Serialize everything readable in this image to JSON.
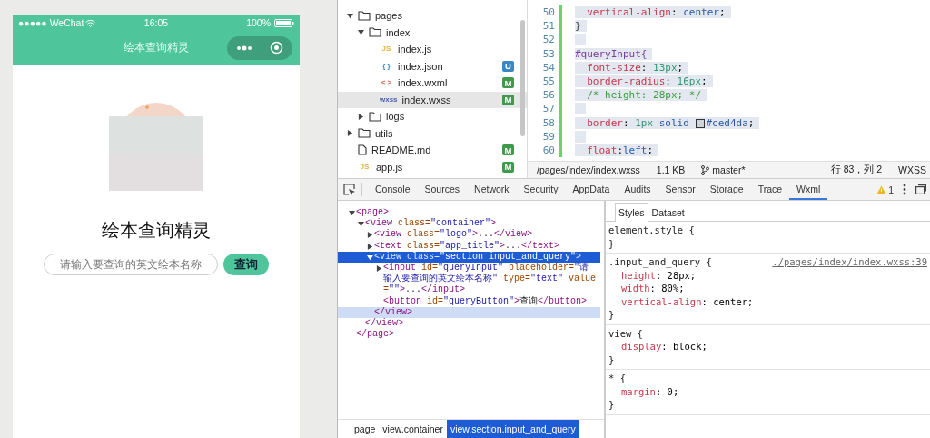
{
  "simulator": {
    "status_bar": {
      "carrier": "●●●●● WeChat",
      "time": "16:05",
      "battery": "100%"
    },
    "nav_title": "绘本查询精灵",
    "app": {
      "title": "绘本查询精灵",
      "search": {
        "placeholder": "请输入要查询的英文绘本名称"
      },
      "query_button": "查询"
    }
  },
  "file_tree": {
    "items": [
      {
        "name": "pages",
        "kind": "folder",
        "expanded": true,
        "selected": false,
        "children": [
          {
            "name": "index",
            "kind": "folder",
            "expanded": true,
            "selected": false,
            "children": [
              {
                "name": "index.js",
                "kind": "js",
                "icon_text": "JS",
                "selected": false
              },
              {
                "name": "index.json",
                "kind": "json",
                "icon_text": "{ }",
                "badge": {
                  "text": "U",
                  "color": "#3a87c5"
                },
                "selected": false
              },
              {
                "name": "index.wxml",
                "kind": "wxml",
                "icon_text": "< >",
                "badge": {
                  "text": "M",
                  "color": "#3f9a4c"
                },
                "selected": false
              },
              {
                "name": "index.wxss",
                "kind": "wxss",
                "icon_text": "wxss",
                "badge": {
                  "text": "M",
                  "color": "#3f9a4c"
                },
                "selected": true
              }
            ]
          },
          {
            "name": "logs",
            "kind": "folder",
            "expanded": false,
            "selected": false
          }
        ]
      },
      {
        "name": "utils",
        "kind": "folder",
        "expanded": false,
        "selected": false
      },
      {
        "name": "README.md",
        "kind": "file",
        "badge": {
          "text": "M",
          "color": "#3f9a4c"
        },
        "selected": false
      },
      {
        "name": "app.js",
        "kind": "js",
        "icon_text": "JS",
        "badge": {
          "text": "M",
          "color": "#3f9a4c"
        },
        "selected": false
      }
    ]
  },
  "editor": {
    "lines": [
      {
        "number": "50",
        "code": "  vertical-align: center;",
        "selected": true
      },
      {
        "number": "51",
        "code": "}",
        "selected": true
      },
      {
        "number": "52",
        "selected": true
      },
      {
        "number": "53",
        "code": "#queryInput{",
        "selected": true
      },
      {
        "number": "54",
        "code": "  font-size: 13px;",
        "selected": true
      },
      {
        "number": "55",
        "code": "  border-radius: 16px;",
        "selected": true
      },
      {
        "number": "56",
        "code": "  /* height: 28px; */",
        "selected": true
      },
      {
        "number": "57",
        "selected": true
      },
      {
        "number": "58",
        "code": "  border: 1px solid #ced4da;",
        "selected": true
      },
      {
        "number": "59",
        "selected": true
      },
      {
        "number": "60",
        "code": "  float:left;",
        "selected": true
      }
    ],
    "status_bar": {
      "path": "/pages/index/index.wxss",
      "size": "1.1 KB",
      "branch": "master*",
      "position": "行 83，列 2",
      "language": "WXSS"
    }
  },
  "devtools": {
    "tabs": [
      {
        "label": "Console",
        "selected": false
      },
      {
        "label": "Sources",
        "selected": false
      },
      {
        "label": "Network",
        "selected": false
      },
      {
        "label": "Security",
        "selected": false
      },
      {
        "label": "AppData",
        "selected": false
      },
      {
        "label": "Audits",
        "selected": false
      },
      {
        "label": "Sensor",
        "selected": false
      },
      {
        "label": "Storage",
        "selected": false
      },
      {
        "label": "Trace",
        "selected": false
      },
      {
        "label": "Wxml",
        "selected": true
      }
    ],
    "warnings": "1",
    "elements": [
      {
        "open": "<page>",
        "close": "</page>",
        "close_hovered": false,
        "expanded": true,
        "selected": false,
        "children": [
          {
            "open": "<view class=\"container\">",
            "close": "</view>",
            "close_hovered": false,
            "expanded": true,
            "selected": false,
            "children": [
              {
                "open": "<view class=\"logo\">...</view>",
                "expanded": false,
                "selected": false
              },
              {
                "open": "<text class=\"app_title\">...</text>",
                "expanded": false,
                "selected": false
              },
              {
                "open": "<view class=\"section input_and_query\">",
                "close": "</view>",
                "close_hovered": true,
                "expanded": true,
                "selected": true,
                "children": [
                  {
                    "open": "<input id=\"queryInput\" placeholder=\"请输入要查询的英文绘本名称\" type=\"text\" value=\"\">...</input>",
                    "expanded": false,
                    "selected": false
                  },
                  {
                    "open": "<button id=\"queryButton\">查询</button>",
                    "selected": false
                  }
                ]
              }
            ]
          }
        ]
      }
    ],
    "breadcrumb": [
      {
        "label": "page",
        "selected": false
      },
      {
        "label": "view.container",
        "selected": false
      },
      {
        "label": "view.section.input_and_query",
        "selected": true
      }
    ],
    "style_tabs": [
      {
        "label": "Styles",
        "selected": true
      },
      {
        "label": "Dataset",
        "selected": false
      }
    ],
    "rules": [
      {
        "selector": "element.style {",
        "end": "}"
      },
      {
        "selector": ".input_and_query {",
        "source": "./pages/index/index.wxss:39",
        "declarations": [
          "height: 28px;",
          "width: 80%;",
          "vertical-align: center;"
        ],
        "end": "}"
      },
      {
        "selector": "view {",
        "declarations": [
          "display: block;"
        ],
        "end": "}"
      },
      {
        "selector": "* {",
        "declarations": [
          "margin: 0;"
        ],
        "end": "}"
      }
    ]
  }
}
